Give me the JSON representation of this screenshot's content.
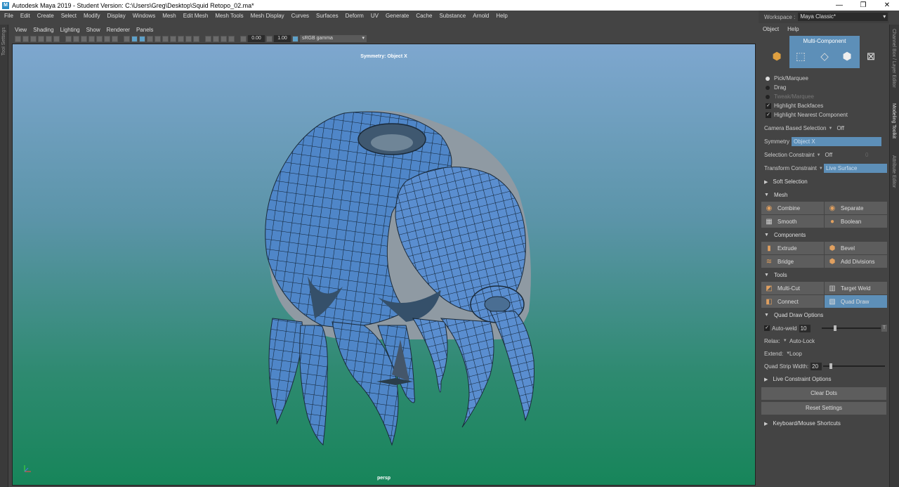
{
  "window": {
    "title": "Autodesk Maya 2019 - Student Version: C:\\Users\\Greg\\Desktop\\Squid Retopo_02.ma*",
    "icon_letter": "M",
    "minimize": "—",
    "maximize": "❐",
    "close": "✕"
  },
  "menubar": [
    "File",
    "Edit",
    "Create",
    "Select",
    "Modify",
    "Display",
    "Windows",
    "Mesh",
    "Edit Mesh",
    "Mesh Tools",
    "Mesh Display",
    "Curves",
    "Surfaces",
    "Deform",
    "UV",
    "Generate",
    "Cache",
    "Substance",
    "Arnold",
    "Help"
  ],
  "left_strip_label": "Tool Settings",
  "panel_menu": [
    "View",
    "Shading",
    "Lighting",
    "Show",
    "Renderer",
    "Panels"
  ],
  "viewport_toolbar": {
    "exposure": "0.00",
    "gamma": "1.00",
    "color_space": "sRGB gamma"
  },
  "viewport": {
    "symmetry_label": "Symmetry: Object X",
    "camera_label": "persp"
  },
  "right_panel": {
    "workspace_label": "Workspace :",
    "workspace_value": "Maya Classic*",
    "menu": [
      "Object",
      "Help"
    ],
    "mode_title": "Multi-Component",
    "select_modes": [
      {
        "label": "Pick/Marquee",
        "on": true,
        "dim": false
      },
      {
        "label": "Drag",
        "on": false,
        "dim": false
      },
      {
        "label": "Tweak/Marquee",
        "on": false,
        "dim": true
      }
    ],
    "checks": [
      {
        "label": "Highlight Backfaces",
        "mark": "✓"
      },
      {
        "label": "Highlight Nearest Component",
        "mark": "✓"
      }
    ],
    "camera_based_selection": {
      "label": "Camera Based Selection",
      "value": "Off"
    },
    "symmetry": {
      "label": "Symmetry",
      "value": "Object X"
    },
    "selection_constraint": {
      "label": "Selection Constraint",
      "value": "Off",
      "extra": "0"
    },
    "transform_constraint": {
      "label": "Transform Constraint",
      "value": "Live Surface"
    },
    "soft_selection": "Soft Selection",
    "mesh_section": "Mesh",
    "mesh_buttons": [
      "Combine",
      "Separate",
      "Smooth",
      "Boolean"
    ],
    "components_section": "Components",
    "component_buttons": [
      "Extrude",
      "Bevel",
      "Bridge",
      "Add Divisions"
    ],
    "tools_section": "Tools",
    "tool_buttons": [
      "Multi-Cut",
      "Target Weld",
      "Connect",
      "Quad Draw"
    ],
    "quad_draw_options": "Quad Draw Options",
    "auto_weld": {
      "label": "Auto-weld",
      "value": "10",
      "mark": "✓",
      "slider": 0.2,
      "end_button": "T"
    },
    "relax": {
      "label": "Relax:",
      "value": "Auto-Lock"
    },
    "extend": {
      "label": "Extend:",
      "value": "Loop"
    },
    "quad_strip_width": {
      "label": "Quad Strip Width:",
      "value": "20",
      "slider": 0.1
    },
    "live_constraint_options": "Live Constraint Options",
    "clear_dots": "Clear Dots",
    "reset_settings": "Reset Settings",
    "keyboard_shortcuts": "Keyboard/Mouse Shortcuts"
  },
  "right_tabs": [
    "Channel Box / Layer Editor",
    "Modeling Toolkit",
    "Attribute Editor"
  ],
  "colors": {
    "accent": "#5d8fb8",
    "mesh_fill": "#4f86c8",
    "viewport_top": "#7ea7cf",
    "viewport_bottom": "#17855a"
  }
}
